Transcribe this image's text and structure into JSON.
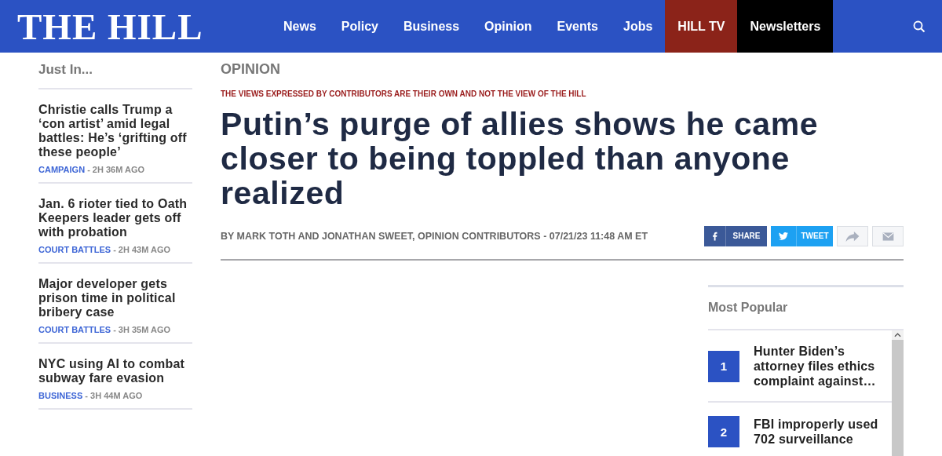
{
  "logo": "THE HILL",
  "nav": [
    {
      "label": "News",
      "kind": "plain"
    },
    {
      "label": "Policy",
      "kind": "plain"
    },
    {
      "label": "Business",
      "kind": "plain"
    },
    {
      "label": "Opinion",
      "kind": "plain"
    },
    {
      "label": "Events",
      "kind": "plain"
    },
    {
      "label": "Jobs",
      "kind": "plain"
    },
    {
      "label": "HILL TV",
      "kind": "red"
    },
    {
      "label": "Newsletters",
      "kind": "black"
    }
  ],
  "just_in": {
    "title": "Just In...",
    "items": [
      {
        "headline": "Christie calls Trump a ‘con artist’ amid legal battles: He’s ‘grifting off these people’",
        "section": "CAMPAIGN",
        "time": "- 2H 36M AGO"
      },
      {
        "headline": "Jan. 6 rioter tied to Oath Keepers leader gets off with probation",
        "section": "COURT BATTLES",
        "time": "- 2H 43M AGO"
      },
      {
        "headline": "Major developer gets prison time in political bribery case",
        "section": "COURT BATTLES",
        "time": "- 3H 35M AGO"
      },
      {
        "headline": "NYC using AI to combat subway fare evasion",
        "section": "BUSINESS",
        "time": "- 3H 44M AGO"
      }
    ]
  },
  "article": {
    "section": "OPINION",
    "disclaimer": "THE VIEWS EXPRESSED BY CONTRIBUTORS ARE THEIR OWN AND NOT THE VIEW OF THE HILL",
    "headline": "Putin’s purge of allies shows he came closer to being toppled than anyone realized",
    "byline": "BY MARK TOTH AND JONATHAN SWEET, OPINION CONTRIBUTORS - 07/21/23 11:48 AM ET",
    "share": [
      {
        "kind": "facebook",
        "label": "SHARE"
      },
      {
        "kind": "twitter",
        "label": "TWEET"
      },
      {
        "kind": "forward"
      },
      {
        "kind": "email"
      }
    ]
  },
  "most_popular": {
    "title": "Most Popular",
    "items": [
      {
        "rank": "1",
        "headline": "Hunter Biden’s attorney files ethics complaint against…"
      },
      {
        "rank": "2",
        "headline": "FBI improperly used 702 surveillance"
      }
    ]
  }
}
